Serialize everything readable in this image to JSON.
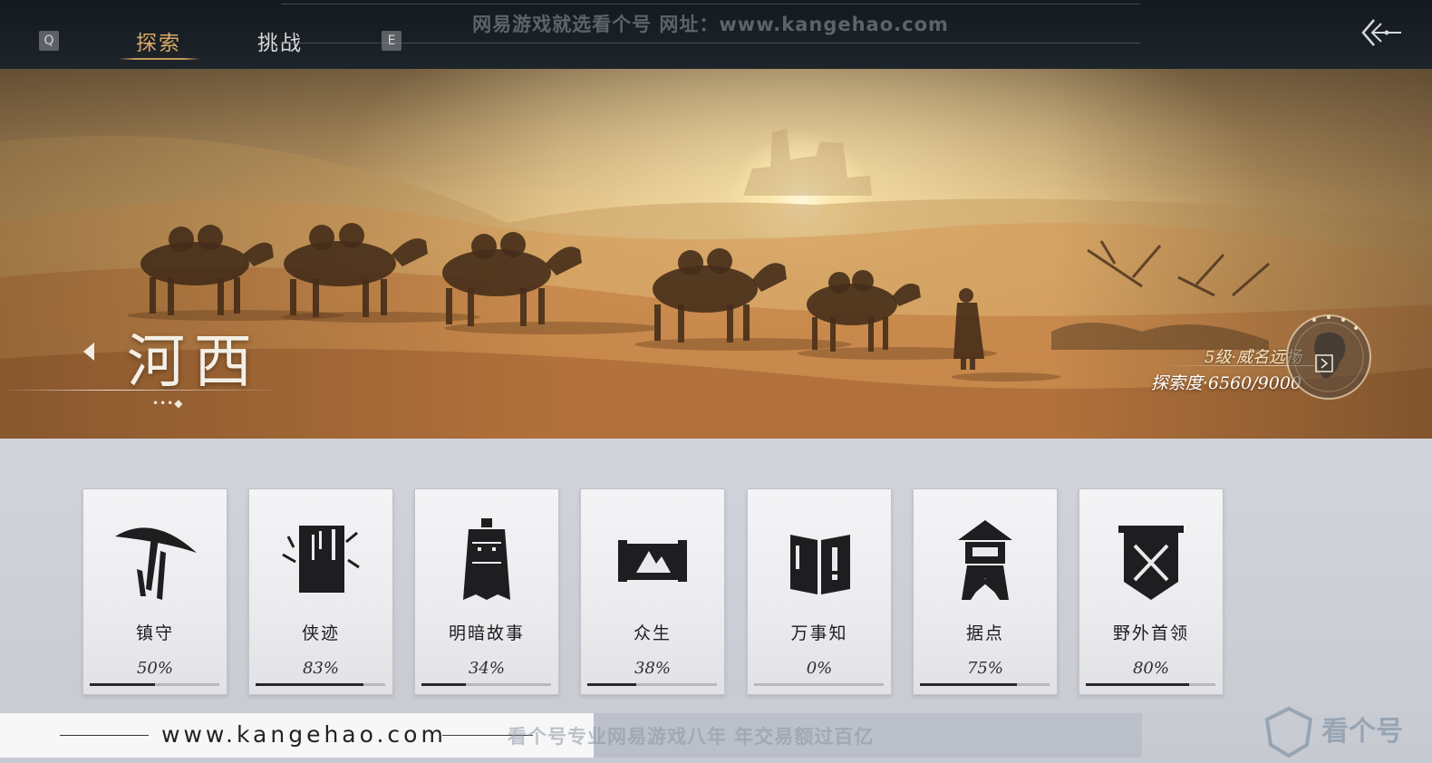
{
  "header": {
    "key_prev": "Q",
    "key_next": "E",
    "tabs": [
      {
        "label": "探索",
        "active": true
      },
      {
        "label": "挑战",
        "active": false
      }
    ],
    "watermark": "网易游戏就选看个号   网址：www.kangehao.com"
  },
  "banner": {
    "region_name": "河西",
    "page_indicator": "•••◆",
    "level": "5级·威名远扬",
    "exploration": "探索度·6560/9000"
  },
  "categories": [
    {
      "label": "镇守",
      "percent_text": "50%",
      "progress": 0.5,
      "icon": "bamboo-hat-icon"
    },
    {
      "label": "侠迹",
      "percent_text": "83%",
      "progress": 0.83,
      "icon": "scroll-book-icon"
    },
    {
      "label": "明暗故事",
      "percent_text": "34%",
      "progress": 0.34,
      "icon": "bell-icon"
    },
    {
      "label": "众生",
      "percent_text": "38%",
      "progress": 0.38,
      "icon": "painting-scroll-icon"
    },
    {
      "label": "万事知",
      "percent_text": "0%",
      "progress": 0.0,
      "icon": "folding-screen-icon"
    },
    {
      "label": "据点",
      "percent_text": "75%",
      "progress": 0.75,
      "icon": "watchtower-icon"
    },
    {
      "label": "野外首领",
      "percent_text": "80%",
      "progress": 0.8,
      "icon": "crossed-swords-banner-icon"
    }
  ],
  "footer": {
    "site": "www.kangehao.com",
    "slogan": "看个号专业网易游戏八年   年交易额过百亿",
    "logo_text": "看个号"
  },
  "colors": {
    "active_tab": "#d9a966",
    "progress_fill": "#26272a",
    "progress_track": "#b8b9bd"
  }
}
